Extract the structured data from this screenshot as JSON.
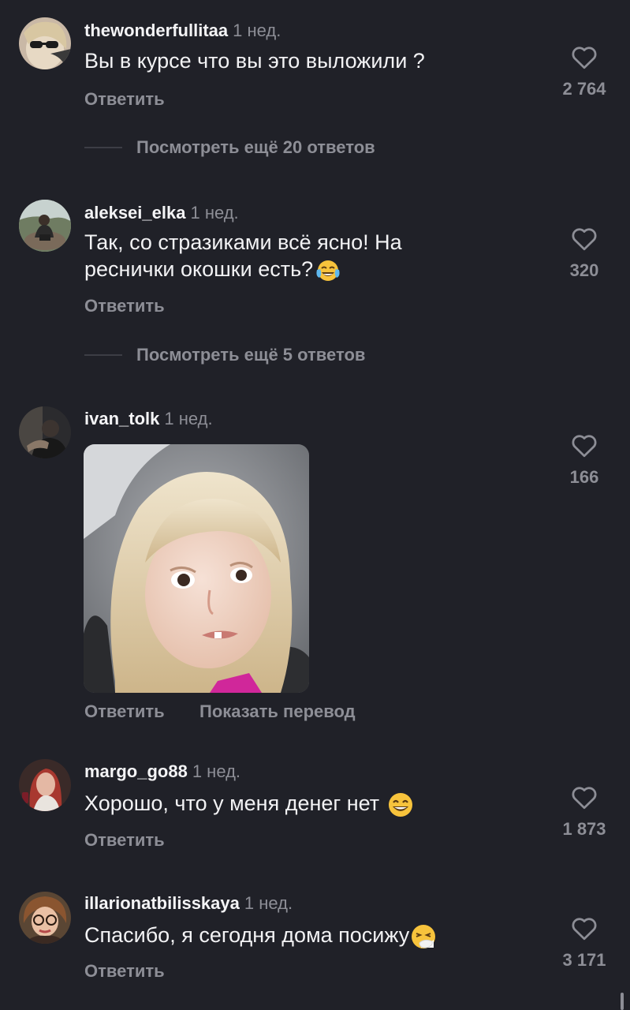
{
  "comments": [
    {
      "username": "thewonderfullitaa",
      "time": "1 нед.",
      "text": "Вы в курсе что вы это выложили ?",
      "reply_label": "Ответить",
      "likes": "2 764",
      "more_replies": "Посмотреть ещё 20 ответов"
    },
    {
      "username": "aleksei_elka",
      "time": "1 нед.",
      "text_line1": "Так, со стразиками всё ясно! На",
      "text_line2": "реснички окошки есть?",
      "emoji": "face-with-tears-of-joy",
      "reply_label": "Ответить",
      "likes": "320",
      "more_replies": "Посмотреть ещё 5 ответов"
    },
    {
      "username": "ivan_tolk",
      "time": "1 нед.",
      "media": "reaction-gif-image",
      "reply_label": "Ответить",
      "translate_label": "Показать перевод",
      "likes": "166"
    },
    {
      "username": "margo_go88",
      "time": "1 нед.",
      "text": "Хорошо, что у меня денег нет",
      "emoji": "grinning-face-with-smiling-eyes",
      "reply_label": "Ответить",
      "likes": "1 873"
    },
    {
      "username": "illarionatbilisskaya",
      "time": "1 нед.",
      "text": "Спасибо, я сегодня дома посижу",
      "emoji": "sneezing-face",
      "reply_label": "Ответить",
      "likes": "3 171"
    }
  ],
  "icons": {
    "like": "heart-outline-icon"
  },
  "colors": {
    "background": "#202128",
    "primary_text": "#f2f2f4",
    "secondary_text": "#8d8e96"
  }
}
